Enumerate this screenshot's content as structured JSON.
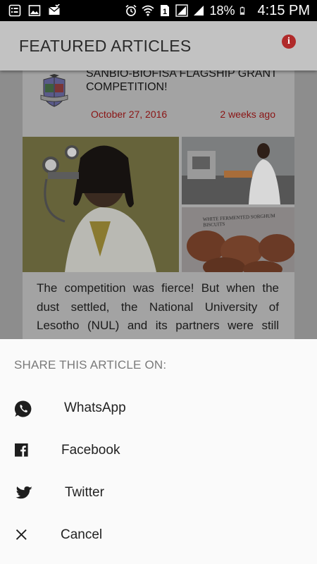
{
  "status_bar": {
    "battery_percent": "18%",
    "time": "4:15 PM",
    "notification_icons": [
      "list-icon",
      "image-icon",
      "mail-check-icon"
    ],
    "system_icons": [
      "alarm-icon",
      "wifi-icon",
      "sim-1-icon",
      "signal-icon",
      "signal-icon",
      "battery-icon"
    ]
  },
  "app_bar": {
    "title": "FEATURED ARTICLES",
    "info_icon": "info-icon",
    "info_glyph": "i"
  },
  "article": {
    "title": "SANBIO-BIOFISA FLAGSHIP GRANT COMPETITION!",
    "date": "October 27, 2016",
    "relative_time": "2 weeks ago",
    "photo_label": "WHITE FERMENTED SORGHUM BISCUITS",
    "excerpt": "The competition was fierce! But when the dust settled, the National University of Lesotho (NUL) and its partners were still"
  },
  "share_sheet": {
    "header": "SHARE THIS ARTICLE ON:",
    "items": [
      {
        "label": "WhatsApp",
        "icon": "whatsapp-icon"
      },
      {
        "label": "Facebook",
        "icon": "facebook-icon"
      },
      {
        "label": "Twitter",
        "icon": "twitter-icon"
      },
      {
        "label": "Cancel",
        "icon": "close-icon"
      }
    ]
  },
  "colors": {
    "scrim_appbar": "#c2c2c2",
    "date_red": "#8a1414",
    "info_red": "#b02a2a",
    "sheet_bg": "#fafafa"
  }
}
